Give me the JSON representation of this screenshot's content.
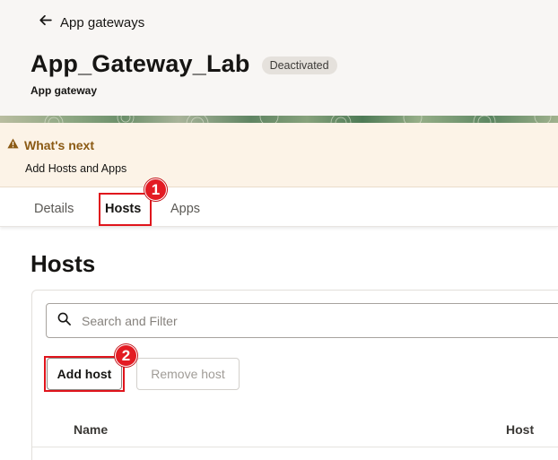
{
  "header": {
    "back_label": "App gateways",
    "title": "App_Gateway_Lab",
    "status": "Deactivated",
    "subtitle": "App gateway"
  },
  "notice": {
    "title": "What's next",
    "text": "Add Hosts and Apps",
    "accent_color": "#8b5a14"
  },
  "tabs": [
    {
      "label": "Details",
      "active": false
    },
    {
      "label": "Hosts",
      "active": true
    },
    {
      "label": "Apps",
      "active": false
    }
  ],
  "section": {
    "title": "Hosts"
  },
  "search": {
    "placeholder": "Search and Filter",
    "value": ""
  },
  "toolbar": {
    "add_label": "Add host",
    "remove_label": "Remove host"
  },
  "table": {
    "columns": [
      "Name",
      "Host"
    ]
  },
  "annotations": {
    "markers": [
      "1",
      "2"
    ],
    "color": "#e31b23"
  },
  "icons": {
    "back": "arrow-left-icon",
    "warning": "warning-triangle-icon",
    "search": "search-icon"
  }
}
